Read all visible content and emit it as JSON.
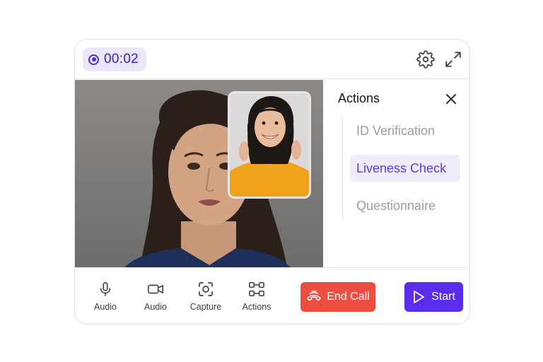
{
  "header": {
    "timer": "00:02",
    "record_icon": "record-icon",
    "settings_icon": "gear-icon",
    "expand_icon": "expand-icon"
  },
  "panel": {
    "title": "Actions",
    "close_icon": "close-icon",
    "items": [
      {
        "label": "ID Verification",
        "active": false
      },
      {
        "label": "Liveness Check",
        "active": true
      },
      {
        "label": "Questionnaire",
        "active": false
      }
    ]
  },
  "controls": [
    {
      "label": "Audio",
      "icon": "microphone-icon"
    },
    {
      "label": "Audio",
      "icon": "video-camera-icon"
    },
    {
      "label": "Capture",
      "icon": "capture-icon"
    },
    {
      "label": "Actions",
      "icon": "actions-grid-icon"
    }
  ],
  "end_call": {
    "label": "End Call",
    "icon": "phone-hangup-icon"
  },
  "start": {
    "label": "Start",
    "icon": "play-icon"
  },
  "colors": {
    "accent": "#5a2dec",
    "danger": "#ee4d41",
    "timer_bg": "#ebe6fb",
    "active_item_bg": "#efecfb"
  }
}
